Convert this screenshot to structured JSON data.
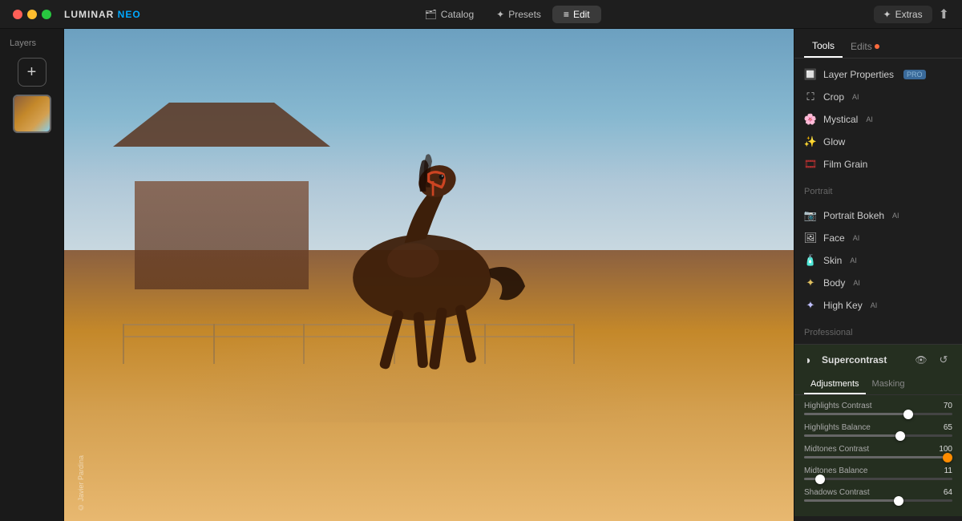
{
  "app": {
    "name": "LUMINAR",
    "name_styled": "NEO",
    "traffic_lights": [
      "red",
      "yellow",
      "green"
    ]
  },
  "titlebar": {
    "nav_items": [
      {
        "id": "catalog",
        "label": "Catalog",
        "icon": "🗂",
        "active": false
      },
      {
        "id": "presets",
        "label": "Presets",
        "icon": "✦",
        "active": false
      },
      {
        "id": "edit",
        "label": "Edit",
        "icon": "≡",
        "active": true
      }
    ],
    "extras_label": "Extras"
  },
  "sidebar": {
    "title": "Layers",
    "add_label": "+"
  },
  "canvas": {
    "copyright": "© Javier Pardina"
  },
  "right_panel": {
    "tabs": [
      {
        "id": "tools",
        "label": "Tools",
        "active": true,
        "has_dot": false
      },
      {
        "id": "edits",
        "label": "Edits",
        "active": false,
        "has_dot": true
      }
    ],
    "tools": [
      {
        "id": "layer-properties",
        "label": "Layer Properties",
        "icon": "🔲",
        "badge": "PRO"
      },
      {
        "id": "crop",
        "label": "Crop",
        "icon": "⛶",
        "ai": "AI"
      },
      {
        "id": "mystical",
        "label": "Mystical",
        "icon": "🌸",
        "ai": "AI"
      },
      {
        "id": "glow",
        "label": "Glow",
        "icon": "✨",
        "ai": null
      },
      {
        "id": "film-grain",
        "label": "Film Grain",
        "icon": "🎞",
        "ai": null
      }
    ],
    "portrait_section_label": "Portrait",
    "portrait_tools": [
      {
        "id": "portrait-bokeh",
        "label": "Portrait Bokeh",
        "icon": "📷",
        "ai": "AI"
      },
      {
        "id": "face",
        "label": "Face",
        "icon": "🖼",
        "ai": "AI"
      },
      {
        "id": "skin",
        "label": "Skin",
        "icon": "🧴",
        "ai": "AI"
      },
      {
        "id": "body",
        "label": "Body",
        "icon": "✦",
        "ai": "AI"
      },
      {
        "id": "high-key",
        "label": "High Key",
        "icon": "✦",
        "ai": "AI"
      }
    ],
    "professional_section_label": "Professional",
    "supercontrast": {
      "title": "Supercontrast",
      "icon": "◑",
      "tabs": [
        {
          "id": "adjustments",
          "label": "Adjustments",
          "active": true
        },
        {
          "id": "masking",
          "label": "Masking",
          "active": false
        }
      ],
      "sliders": [
        {
          "label": "Highlights Contrast",
          "value": 70,
          "percent": 70,
          "thumb_pct": 70,
          "orange": false
        },
        {
          "label": "Highlights Balance",
          "value": 65,
          "percent": 65,
          "thumb_pct": 65,
          "orange": false
        },
        {
          "label": "Midtones Contrast",
          "value": 100,
          "percent": 100,
          "thumb_pct": 100,
          "orange": true
        },
        {
          "label": "Midtones Balance",
          "value": 11,
          "percent": 11,
          "thumb_pct": 11,
          "orange": false
        },
        {
          "label": "Shadows Contrast",
          "value": 64,
          "percent": 64,
          "thumb_pct": 64,
          "orange": false
        }
      ]
    }
  }
}
